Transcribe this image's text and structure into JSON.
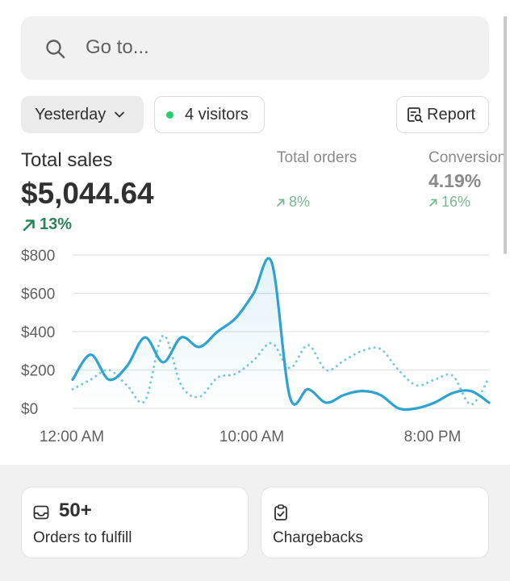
{
  "search": {
    "placeholder": "Go to..."
  },
  "filters": {
    "date_label": "Yesterday",
    "visitors_label": "4 visitors",
    "report_label": "Report"
  },
  "metrics": {
    "total_sales": {
      "label": "Total sales",
      "value": "$5,044.64",
      "change": "13%"
    },
    "total_orders": {
      "label": "Total orders",
      "change": "8%"
    },
    "conversion": {
      "label": "Conversion",
      "value": "4.19%",
      "change": "16%"
    }
  },
  "chart_data": {
    "type": "line",
    "title": "",
    "xlabel": "",
    "ylabel": "",
    "y_ticks": [
      "$800",
      "$600",
      "$400",
      "$200",
      "$0"
    ],
    "x_ticks": [
      "12:00 AM",
      "10:00 AM",
      "8:00 PM"
    ],
    "ylim": [
      0,
      800
    ],
    "grid": true,
    "colors": {
      "current": "#2ea3cf",
      "previous": "#7ec8dc"
    },
    "series": [
      {
        "style": "solid",
        "values": [
          150,
          280,
          150,
          220,
          370,
          240,
          370,
          320,
          400,
          470,
          600,
          760,
          60,
          100,
          30,
          70,
          90,
          70,
          0,
          0,
          30,
          80,
          90,
          30
        ]
      },
      {
        "style": "dotted",
        "values": [
          100,
          150,
          200,
          120,
          40,
          380,
          120,
          60,
          160,
          180,
          250,
          340,
          210,
          330,
          200,
          250,
          300,
          310,
          200,
          120,
          150,
          170,
          20,
          160
        ]
      }
    ]
  },
  "tasks": [
    {
      "count": "50+",
      "label": "Orders to fulfill"
    },
    {
      "count": "",
      "label": "Chargebacks"
    }
  ]
}
